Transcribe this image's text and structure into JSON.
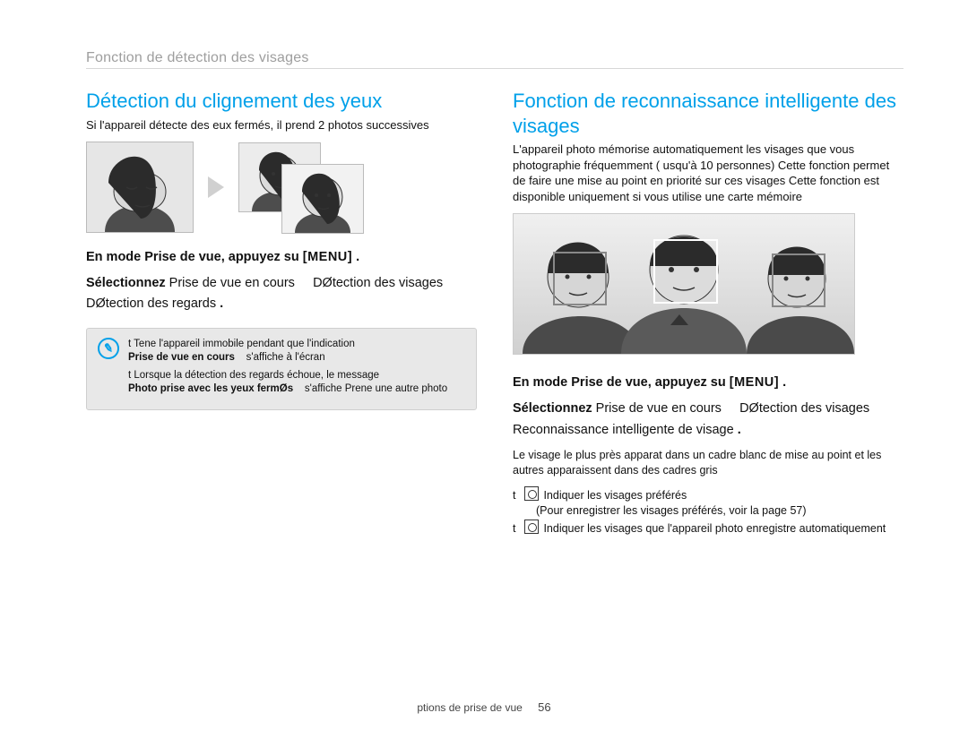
{
  "header": {
    "title": "Fonction de détection des visages"
  },
  "left": {
    "heading": "Détection du clignement des yeux",
    "intro": "Si l'appareil détecte des  eux fermés, il prend 2 photos successives",
    "step1_a": "En mode Prise de vue, appuyez su",
    "step1_b": "[MENU]",
    "step1_c": ".",
    "step2_a": "Sélectionnez",
    "step2_b": "Prise de vue en cours",
    "step2_c": "DØtection des visages",
    "step2_d": "DØtection des regards",
    "step2_e": ".",
    "info": {
      "line1_pre": "t   Tene  l'appareil immobile pendant que l'indication",
      "line1_hl": "Prise de vue en cours",
      "line1_post": "s'affiche à l'écran",
      "line2_pre": "t   Lorsque la détection des regards échoue, le message",
      "line2_hl": "Photo prise avec les yeux fermØs",
      "line2_post": "s'affiche  Prene  une autre photo"
    }
  },
  "right": {
    "heading": "Fonction de reconnaissance intelligente des visages",
    "intro": "L'appareil photo mémorise automatiquement les visages que vous photographie  fréquemment ( usqu'à 10 personnes)  Cette fonction permet de faire une mise au point en priorité sur ces visages  Cette fonction est disponible uniquement si vous utilise  une carte mémoire",
    "step1_a": "En mode Prise de vue, appuyez su",
    "step1_b": "[MENU]",
    "step1_c": ".",
    "step2_a": "Sélectionnez",
    "step2_b": "Prise de vue en cours",
    "step2_c": "DØtection des visages",
    "step2_d": "Reconnaissance intelligente de visage",
    "step2_e": ".",
    "explain": "Le visage le plus près apparat dans un cadre blanc de mise au point et les autres apparaissent dans des cadres gris",
    "bullets": {
      "b1": "Indiquer les visages préférés",
      "b1_sub": "(Pour enregistrer les visages préférés, voir la page 57)",
      "b2": "Indiquer les visages que l'appareil photo enregistre automatiquement"
    }
  },
  "footer": {
    "section": "ptions de prise de vue",
    "page": "56"
  }
}
